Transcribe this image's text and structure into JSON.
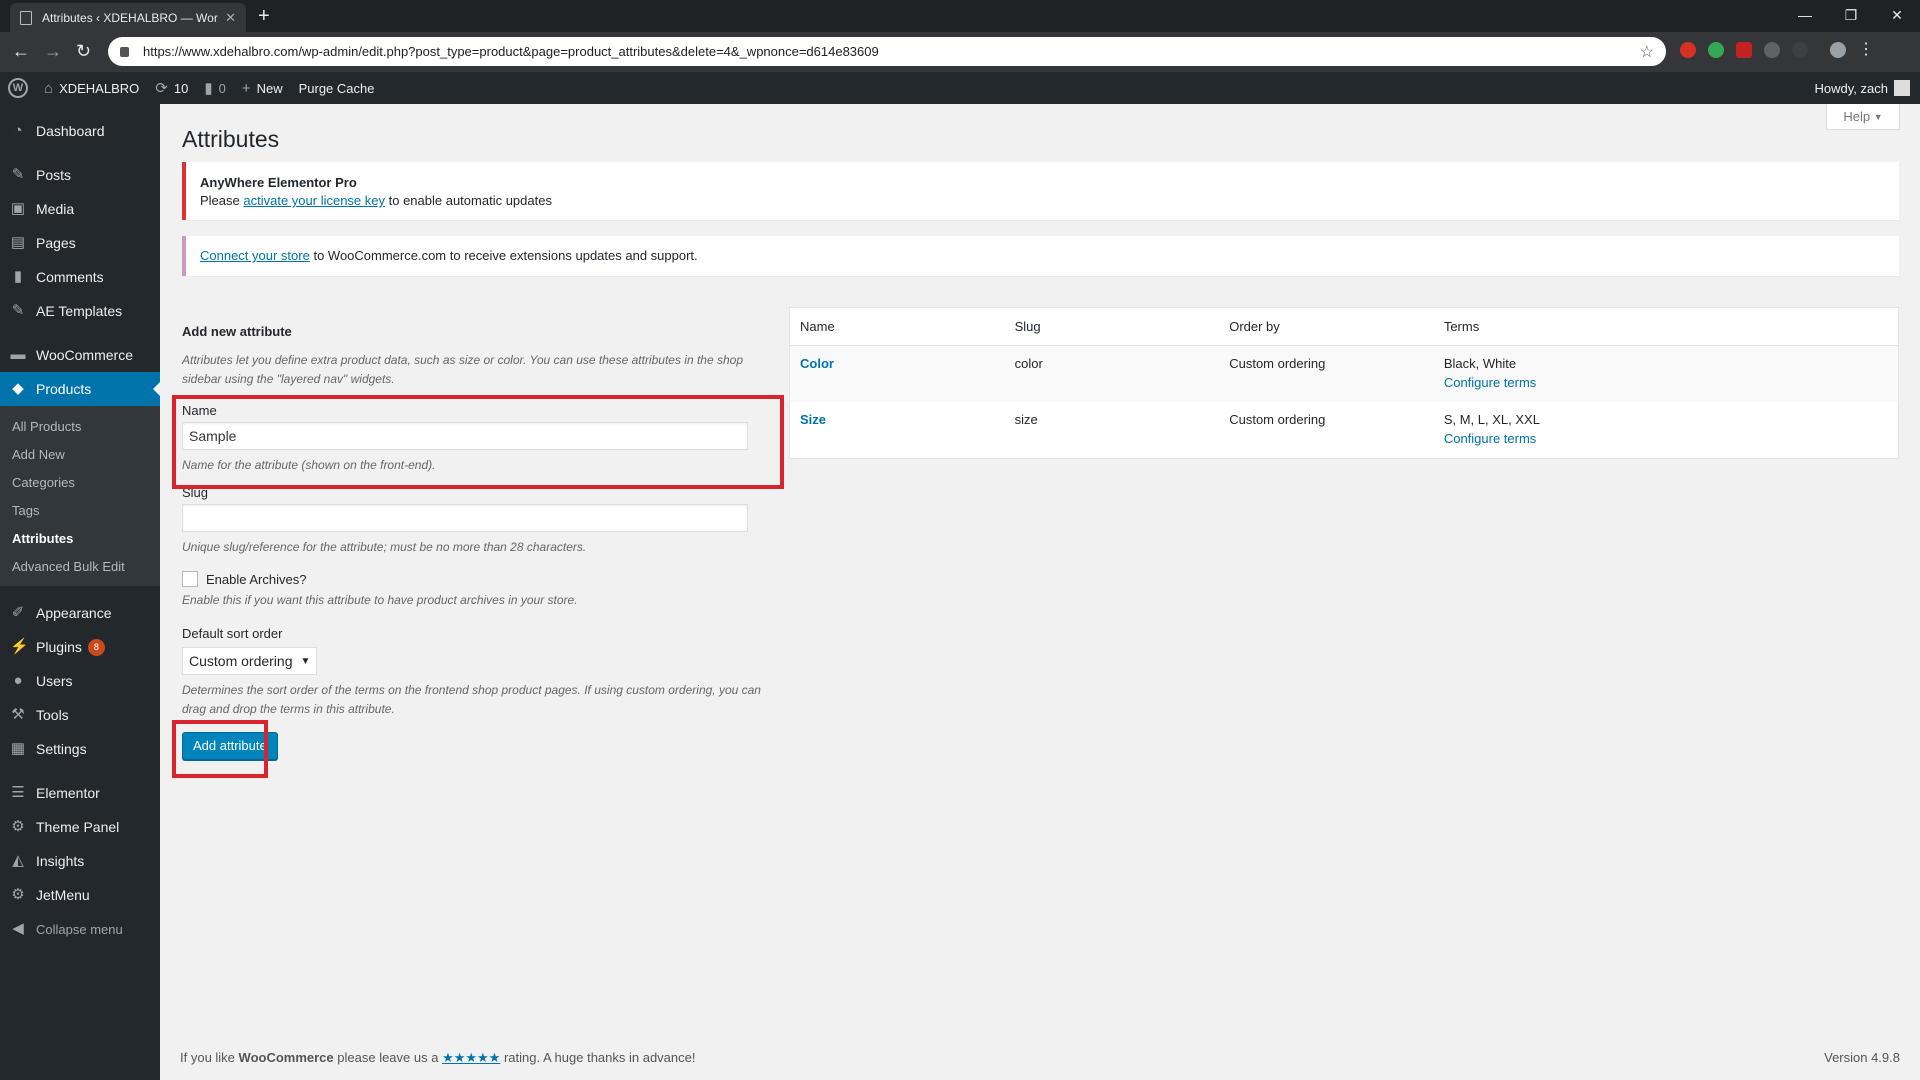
{
  "browser": {
    "tab_title": "Attributes ‹ XDEHALBRO — Wor",
    "url": "https://www.xdehalbro.com/wp-admin/edit.php?post_type=product&page=product_attributes&delete=4&_wpnonce=d614e83609"
  },
  "adminbar": {
    "site_name": "XDEHALBRO",
    "updates_count": "10",
    "comments_count": "0",
    "new_label": "New",
    "purge_label": "Purge Cache",
    "howdy": "Howdy, zach"
  },
  "sidebar": {
    "items": {
      "dashboard": "Dashboard",
      "posts": "Posts",
      "media": "Media",
      "pages": "Pages",
      "comments": "Comments",
      "ae_templates": "AE Templates",
      "woocommerce": "WooCommerce",
      "products": "Products",
      "appearance": "Appearance",
      "plugins": "Plugins",
      "plugins_badge": "8",
      "users": "Users",
      "tools": "Tools",
      "settings": "Settings",
      "elementor": "Elementor",
      "theme_panel": "Theme Panel",
      "insights": "Insights",
      "jetmenu": "JetMenu",
      "collapse": "Collapse menu"
    },
    "submenu": {
      "all_products": "All Products",
      "add_new": "Add New",
      "categories": "Categories",
      "tags": "Tags",
      "attributes": "Attributes",
      "bulk_edit": "Advanced Bulk Edit"
    }
  },
  "main": {
    "help": "Help",
    "title": "Attributes",
    "notice1": {
      "title": "AnyWhere Elementor Pro",
      "pre": "Please ",
      "link": "activate your license key",
      "post": " to enable automatic updates"
    },
    "notice2": {
      "link": "Connect your store",
      "post": " to WooCommerce.com to receive extensions updates and support."
    },
    "form": {
      "heading": "Add new attribute",
      "intro": "Attributes let you define extra product data, such as size or color. You can use these attributes in the shop sidebar using the \"layered nav\" widgets.",
      "name_label": "Name",
      "name_value": "Sample",
      "name_desc": "Name for the attribute (shown on the front-end).",
      "slug_label": "Slug",
      "slug_value": "",
      "slug_desc": "Unique slug/reference for the attribute; must be no more than 28 characters.",
      "archives_label": "Enable Archives?",
      "archives_desc": "Enable this if you want this attribute to have product archives in your store.",
      "sort_label": "Default sort order",
      "sort_value": "Custom ordering",
      "sort_desc": "Determines the sort order of the terms on the frontend shop product pages. If using custom ordering, you can drag and drop the terms in this attribute.",
      "submit": "Add attribute"
    },
    "table": {
      "headers": [
        "Name",
        "Slug",
        "Order by",
        "Terms"
      ],
      "rows": [
        {
          "name": "Color",
          "slug": "color",
          "order": "Custom ordering",
          "terms": "Black, White",
          "configure": "Configure terms"
        },
        {
          "name": "Size",
          "slug": "size",
          "order": "Custom ordering",
          "terms": "S, M, L, XL, XXL",
          "configure": "Configure terms"
        }
      ]
    },
    "footer": {
      "pre": "If you like ",
      "brand": "WooCommerce",
      "mid": " please leave us a ",
      "stars": "★★★★★",
      "post": " rating. A huge thanks in advance!",
      "version": "Version 4.9.8"
    }
  }
}
